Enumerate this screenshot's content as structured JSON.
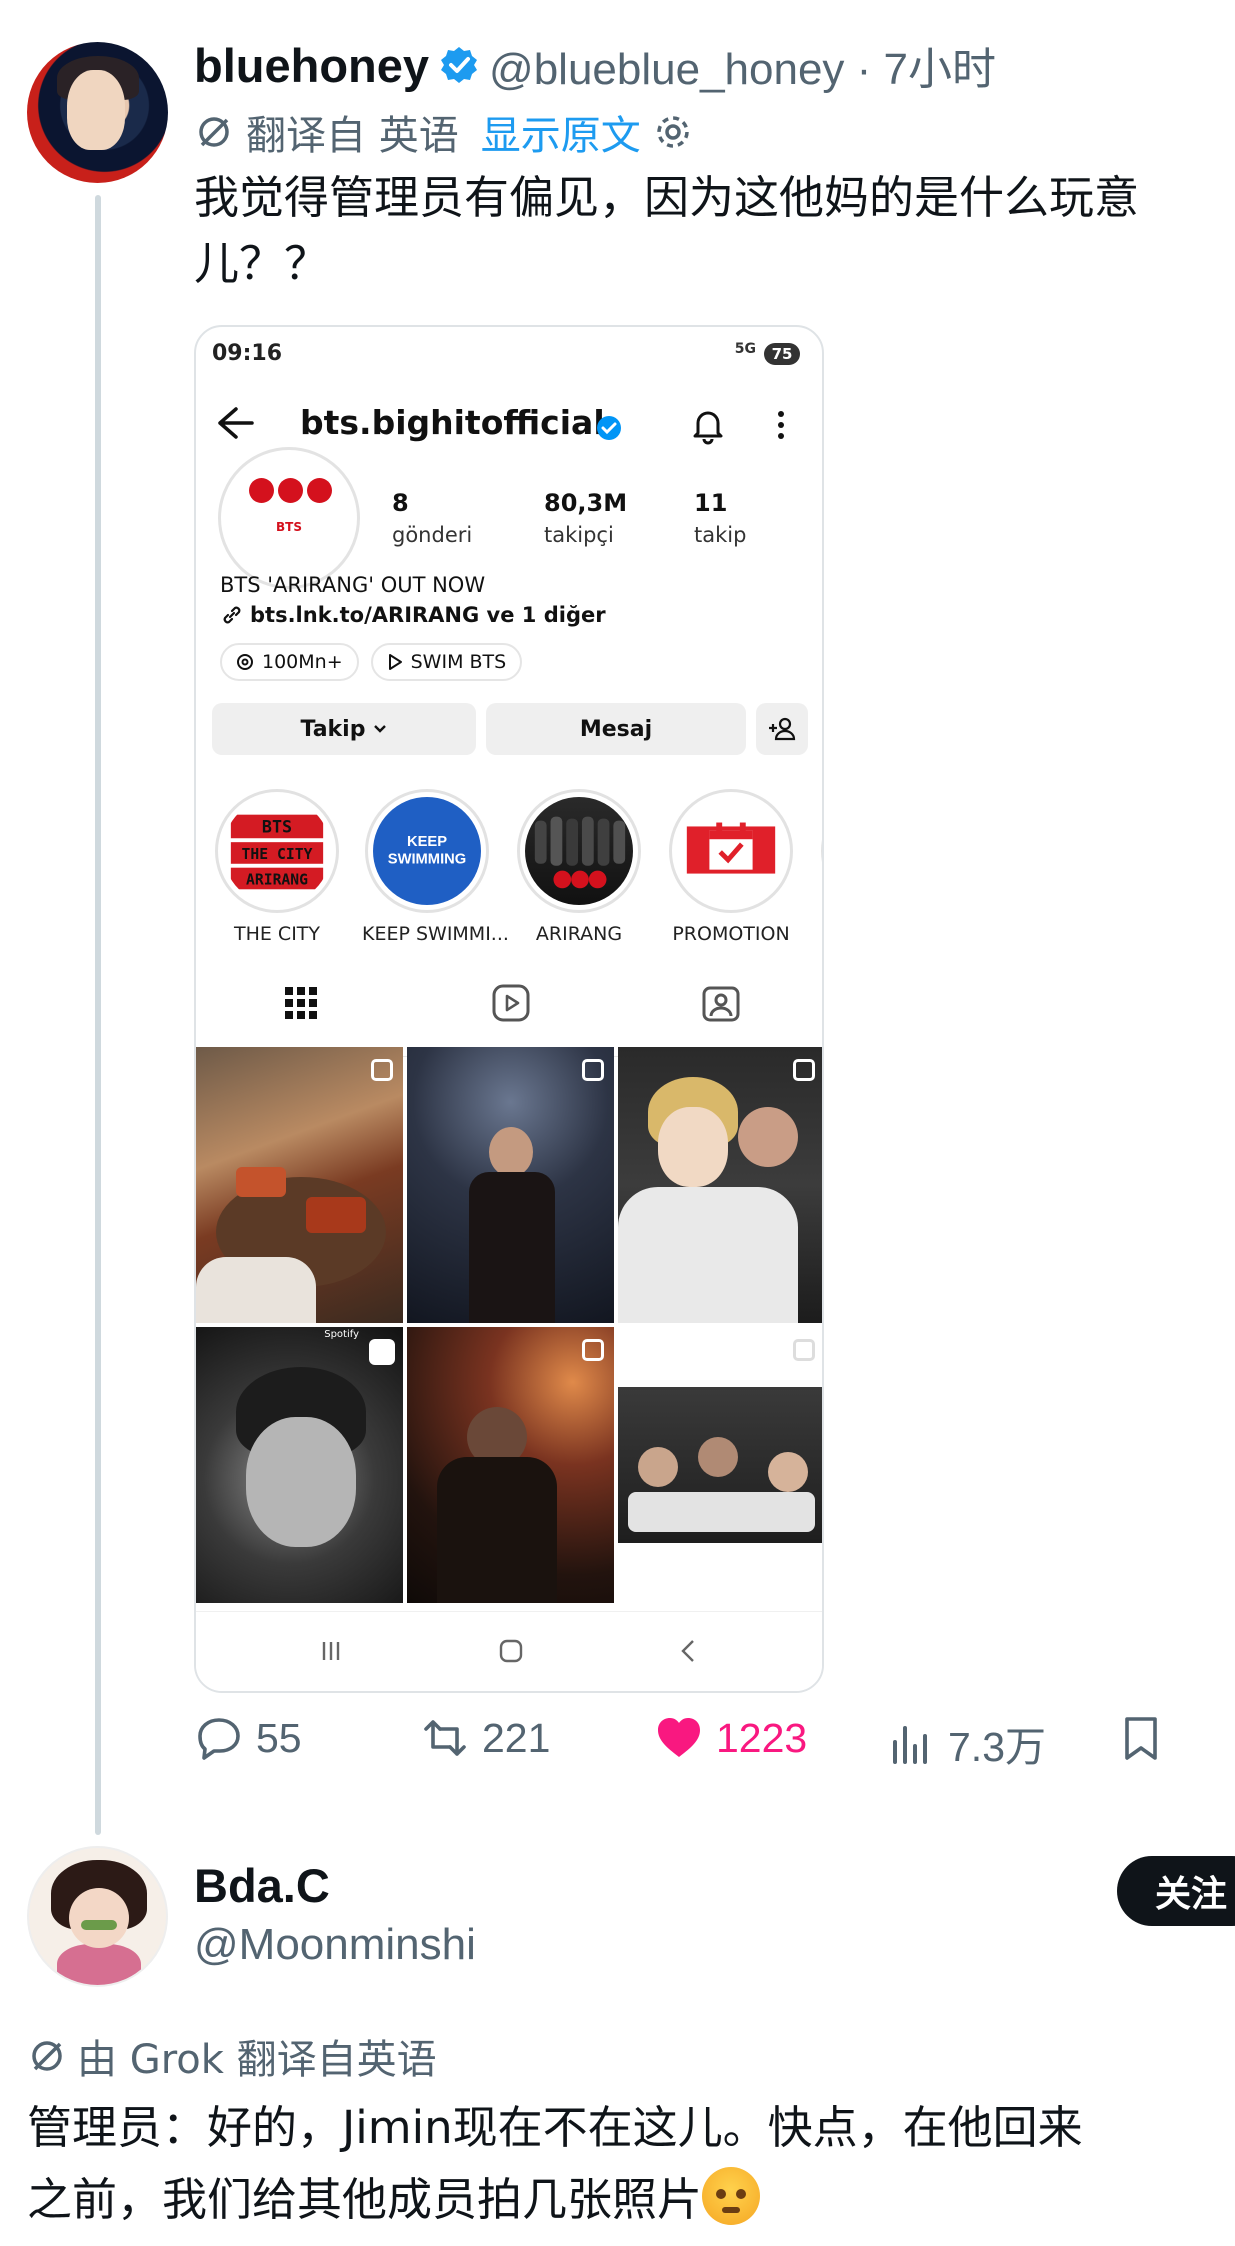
{
  "tweet": {
    "display_name": "bluehoney",
    "handle_time": "@blueblue_honey · 7小时",
    "translated_label": "翻译自 英语",
    "show_original": "显示原文",
    "text_line1": "我觉得管理员有偏见，因为这他妈的是什么玩意",
    "text_line2": "儿？？",
    "stats": {
      "replies": "55",
      "retweets": "221",
      "likes": "1223",
      "views": "7.3万"
    },
    "colors": {
      "like": "#f91880",
      "link": "#1d9bf0",
      "muted": "#536471"
    }
  },
  "screenshot": {
    "status_time": "09:16",
    "status_signal": "5G",
    "battery": "75",
    "username": "bts.bighitofficial",
    "profile_logo_text": "BTS",
    "stats": [
      {
        "value": "8",
        "label": "gönderi"
      },
      {
        "value": "80,3M",
        "label": "takipçi"
      },
      {
        "value": "11",
        "label": "takip"
      }
    ],
    "bio_line": "BTS 'ARIRANG' OUT NOW",
    "link_line": "bts.lnk.to/ARIRANG ve 1 diğer",
    "chips": [
      "100Mn+",
      "SWIM BTS"
    ],
    "buttons": {
      "follow": "Takip",
      "message": "Mesaj"
    },
    "highlights": [
      {
        "caption": "THE CITY",
        "art": "BTS\nTHE CITY\nARIRANG"
      },
      {
        "caption": "KEEP SWIMMI...",
        "art": "KEEP\nSWIMMING"
      },
      {
        "caption": "ARIRANG"
      },
      {
        "caption": "PROMOTION"
      }
    ],
    "grid_badge": "Spotify"
  },
  "reply": {
    "display_name": "Bda.C",
    "handle": "@Moonminshi",
    "follow_label": "关注",
    "translated_label": "由 Grok 翻译自英语",
    "text_line1": "管理员：好的，Jimin现在不在这儿。快点，在他回来",
    "text_line2": "之前，我们给其他成员拍几张照片"
  }
}
